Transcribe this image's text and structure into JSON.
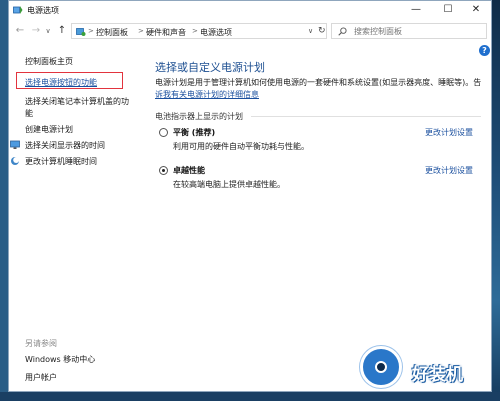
{
  "window": {
    "title": "电源选项"
  },
  "titlebar": {
    "minimize": "—",
    "maximize": "☐",
    "close": "✕"
  },
  "nav": {
    "back": "←",
    "forward": "→",
    "recent": "∨",
    "up": "↑",
    "breadcrumb": [
      "控制面板",
      "硬件和声音",
      "电源选项"
    ],
    "separator": ">",
    "dropdown": "∨",
    "refresh": "↻",
    "search_placeholder": "搜索控制面板"
  },
  "help": {
    "label": "?"
  },
  "sidebar": {
    "home": "控制面板主页",
    "links": [
      "选择电源按钮的功能",
      "选择关闭笔记本计算机盖的功",
      "能",
      "创建电源计划",
      "选择关闭显示器的时间",
      "更改计算机睡眠时间"
    ],
    "see_also_title": "另请参阅",
    "see_also": [
      "Windows 移动中心",
      "用户帐户"
    ]
  },
  "main": {
    "title": "选择或自定义电源计划",
    "desc_line1": "电源计划是用于管理计算机如何使用电源的一套硬件和系统设置(如显示器亮度、睡眠等)。告",
    "desc_line2": "诉我有关电源计划的详细信息",
    "section_label": "电池指示器上显示的计划",
    "plans": [
      {
        "name": "平衡 (推荐)",
        "description": "利用可用的硬件自动平衡功耗与性能。",
        "change": "更改计划设置",
        "selected": false
      },
      {
        "name": "卓越性能",
        "description": "在较高端电脑上提供卓越性能。",
        "change": "更改计划设置",
        "selected": true
      }
    ]
  },
  "watermark": {
    "text": "好装机"
  },
  "colors": {
    "accent": "#1d4f91",
    "link": "#1a4f9e",
    "highlight_box": "#e2343e",
    "desktop": "#1b4a73"
  }
}
